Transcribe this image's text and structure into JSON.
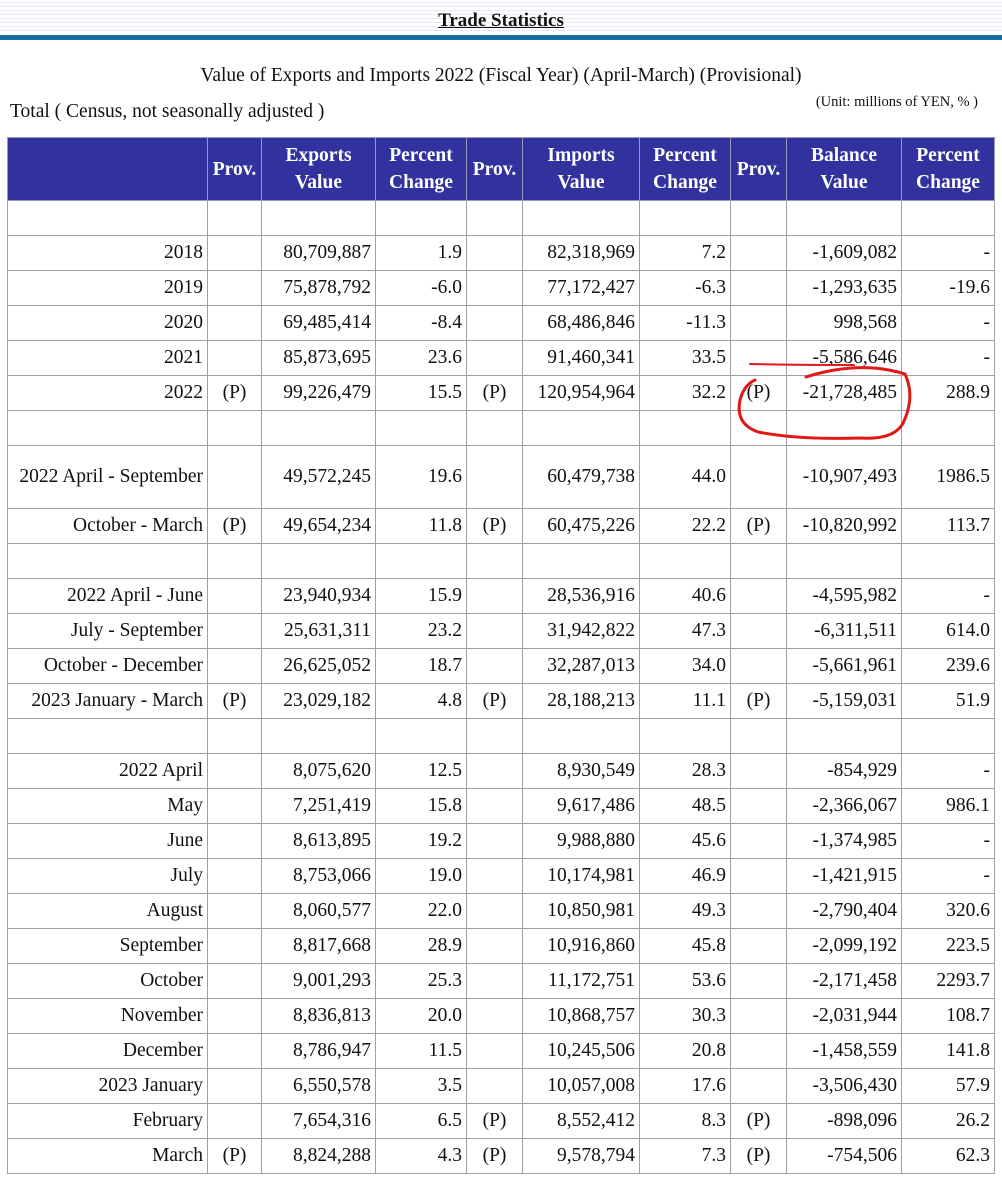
{
  "page_title": "Trade Statistics",
  "table_title": "Value of Exports and Imports 2022 (Fiscal Year) (April-March) (Provisional)",
  "subtitle": "Total ( Census, not seasonally adjusted )",
  "unit_note": "(Unit: millions of YEN, % )",
  "columns": {
    "period": "",
    "exports_prov": "Prov.",
    "exports_value_1": "Exports",
    "exports_value_2": "Value",
    "exports_pct_1": "Percent",
    "exports_pct_2": "Change",
    "imports_prov": "Prov.",
    "imports_value_1": "Imports",
    "imports_value_2": "Value",
    "imports_pct_1": "Percent",
    "imports_pct_2": "Change",
    "balance_prov": "Prov.",
    "balance_value_1": "Balance",
    "balance_value_2": "Value",
    "balance_pct_1": "Percent",
    "balance_pct_2": "Change"
  },
  "rows": [
    {
      "blank": true
    },
    {
      "period": "2018",
      "ep": "",
      "ev": "80,709,887",
      "ec": "1.9",
      "ip": "",
      "iv": "82,318,969",
      "ic": "7.2",
      "bp": "",
      "bv": "-1,609,082",
      "bc": "-"
    },
    {
      "period": "2019",
      "ep": "",
      "ev": "75,878,792",
      "ec": "-6.0",
      "ip": "",
      "iv": "77,172,427",
      "ic": "-6.3",
      "bp": "",
      "bv": "-1,293,635",
      "bc": "-19.6"
    },
    {
      "period": "2020",
      "ep": "",
      "ev": "69,485,414",
      "ec": "-8.4",
      "ip": "",
      "iv": "68,486,846",
      "ic": "-11.3",
      "bp": "",
      "bv": "998,568",
      "bc": "-"
    },
    {
      "period": "2021",
      "ep": "",
      "ev": "85,873,695",
      "ec": "23.6",
      "ip": "",
      "iv": "91,460,341",
      "ic": "33.5",
      "bp": "",
      "bv": "-5,586,646",
      "bc": "-"
    },
    {
      "period": "2022",
      "ep": "(P)",
      "ev": "99,226,479",
      "ec": "15.5",
      "ip": "(P)",
      "iv": "120,954,964",
      "ic": "32.2",
      "bp": "(P)",
      "bv": "-21,728,485",
      "bc": "288.9"
    },
    {
      "blank": true
    },
    {
      "period": "2022 April - September",
      "tall": true,
      "ep": "",
      "ev": "49,572,245",
      "ec": "19.6",
      "ip": "",
      "iv": "60,479,738",
      "ic": "44.0",
      "bp": "",
      "bv": "-10,907,493",
      "bc": "1986.5"
    },
    {
      "period": "October - March",
      "ep": "(P)",
      "ev": "49,654,234",
      "ec": "11.8",
      "ip": "(P)",
      "iv": "60,475,226",
      "ic": "22.2",
      "bp": "(P)",
      "bv": "-10,820,992",
      "bc": "113.7"
    },
    {
      "blank": true
    },
    {
      "period": "2022 April - June",
      "ep": "",
      "ev": "23,940,934",
      "ec": "15.9",
      "ip": "",
      "iv": "28,536,916",
      "ic": "40.6",
      "bp": "",
      "bv": "-4,595,982",
      "bc": "-"
    },
    {
      "period": "July - September",
      "ep": "",
      "ev": "25,631,311",
      "ec": "23.2",
      "ip": "",
      "iv": "31,942,822",
      "ic": "47.3",
      "bp": "",
      "bv": "-6,311,511",
      "bc": "614.0"
    },
    {
      "period": "October - December",
      "ep": "",
      "ev": "26,625,052",
      "ec": "18.7",
      "ip": "",
      "iv": "32,287,013",
      "ic": "34.0",
      "bp": "",
      "bv": "-5,661,961",
      "bc": "239.6"
    },
    {
      "period": "2023 January - March",
      "ep": "(P)",
      "ev": "23,029,182",
      "ec": "4.8",
      "ip": "(P)",
      "iv": "28,188,213",
      "ic": "11.1",
      "bp": "(P)",
      "bv": "-5,159,031",
      "bc": "51.9"
    },
    {
      "blank": true
    },
    {
      "period": "2022 April",
      "ep": "",
      "ev": "8,075,620",
      "ec": "12.5",
      "ip": "",
      "iv": "8,930,549",
      "ic": "28.3",
      "bp": "",
      "bv": "-854,929",
      "bc": "-"
    },
    {
      "period": "May",
      "ep": "",
      "ev": "7,251,419",
      "ec": "15.8",
      "ip": "",
      "iv": "9,617,486",
      "ic": "48.5",
      "bp": "",
      "bv": "-2,366,067",
      "bc": "986.1"
    },
    {
      "period": "June",
      "ep": "",
      "ev": "8,613,895",
      "ec": "19.2",
      "ip": "",
      "iv": "9,988,880",
      "ic": "45.6",
      "bp": "",
      "bv": "-1,374,985",
      "bc": "-"
    },
    {
      "period": "July",
      "ep": "",
      "ev": "8,753,066",
      "ec": "19.0",
      "ip": "",
      "iv": "10,174,981",
      "ic": "46.9",
      "bp": "",
      "bv": "-1,421,915",
      "bc": "-"
    },
    {
      "period": "August",
      "ep": "",
      "ev": "8,060,577",
      "ec": "22.0",
      "ip": "",
      "iv": "10,850,981",
      "ic": "49.3",
      "bp": "",
      "bv": "-2,790,404",
      "bc": "320.6"
    },
    {
      "period": "September",
      "ep": "",
      "ev": "8,817,668",
      "ec": "28.9",
      "ip": "",
      "iv": "10,916,860",
      "ic": "45.8",
      "bp": "",
      "bv": "-2,099,192",
      "bc": "223.5"
    },
    {
      "period": "October",
      "ep": "",
      "ev": "9,001,293",
      "ec": "25.3",
      "ip": "",
      "iv": "11,172,751",
      "ic": "53.6",
      "bp": "",
      "bv": "-2,171,458",
      "bc": "2293.7"
    },
    {
      "period": "November",
      "ep": "",
      "ev": "8,836,813",
      "ec": "20.0",
      "ip": "",
      "iv": "10,868,757",
      "ic": "30.3",
      "bp": "",
      "bv": "-2,031,944",
      "bc": "108.7"
    },
    {
      "period": "December",
      "ep": "",
      "ev": "8,786,947",
      "ec": "11.5",
      "ip": "",
      "iv": "10,245,506",
      "ic": "20.8",
      "bp": "",
      "bv": "-1,458,559",
      "bc": "141.8"
    },
    {
      "period": "2023 January",
      "ep": "",
      "ev": "6,550,578",
      "ec": "3.5",
      "ip": "",
      "iv": "10,057,008",
      "ic": "17.6",
      "bp": "",
      "bv": "-3,506,430",
      "bc": "57.9"
    },
    {
      "period": "February",
      "ep": "",
      "ev": "7,654,316",
      "ec": "6.5",
      "ip": "(P)",
      "iv": "8,552,412",
      "ic": "8.3",
      "bp": "(P)",
      "bv": "-898,096",
      "bc": "26.2"
    },
    {
      "period": "March",
      "ep": "(P)",
      "ev": "8,824,288",
      "ec": "4.3",
      "ip": "(P)",
      "iv": "9,578,794",
      "ic": "7.3",
      "bp": "(P)",
      "bv": "-754,506",
      "bc": "62.3"
    }
  ],
  "colors": {
    "header_background": "#32329f",
    "header_text": "#ffffff",
    "title_rule": "#1a6ea6",
    "annotation": "#e01818"
  }
}
